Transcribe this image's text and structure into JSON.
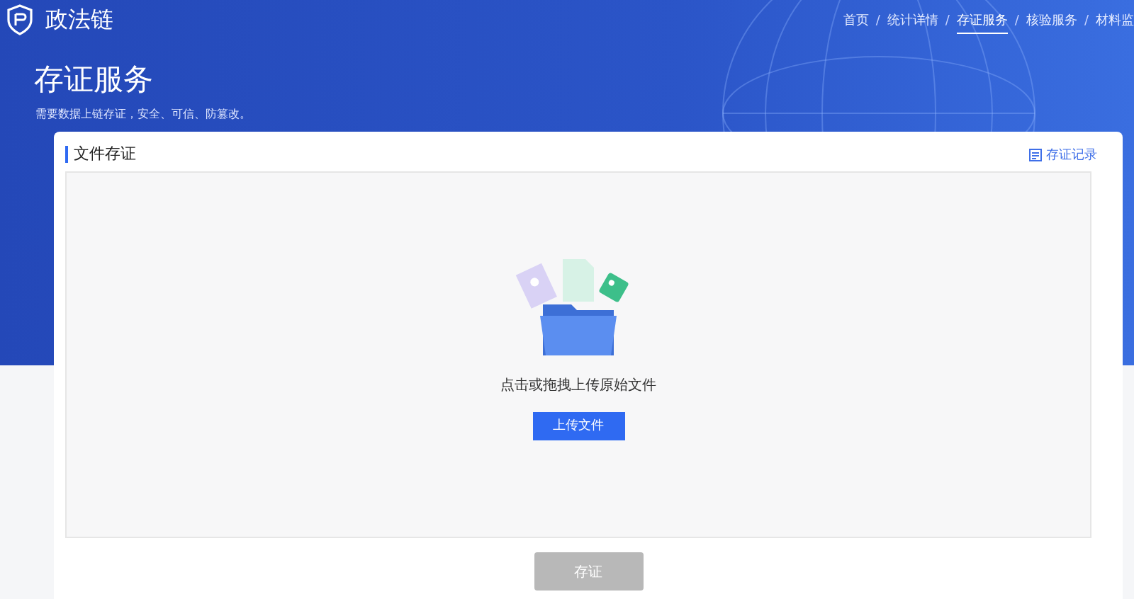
{
  "brand": {
    "name": "政法链"
  },
  "nav": [
    {
      "label": "首页",
      "selected": false
    },
    {
      "separator": "/",
      "label": "统计详情",
      "selected": false
    },
    {
      "separator": "/",
      "label": "存证服务",
      "selected": true
    },
    {
      "separator": "/",
      "label": "核验服务",
      "selected": false
    },
    {
      "separator": "/",
      "label": "材料监",
      "selected": false
    }
  ],
  "hero": {
    "title": "存证服务",
    "subtitle": "需要数据上链存证，安全、可信、防篡改。"
  },
  "card": {
    "title": "文件存证",
    "record_link": "存证记录",
    "upload": {
      "hint": "点击或拖拽上传原始文件",
      "button": "上传文件"
    },
    "submit": {
      "label": "存证",
      "disabled": true
    }
  }
}
